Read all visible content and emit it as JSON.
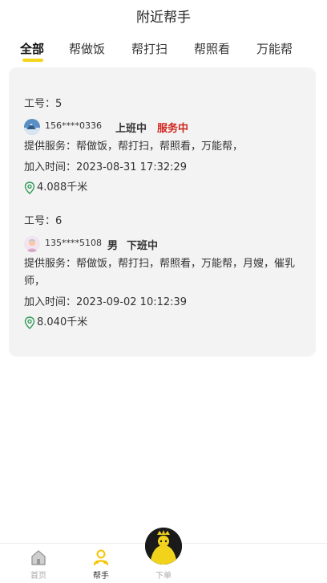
{
  "header": {
    "title": "附近帮手"
  },
  "tabs": [
    {
      "label": "全部",
      "active": true
    },
    {
      "label": "帮做饭",
      "active": false
    },
    {
      "label": "帮打扫",
      "active": false
    },
    {
      "label": "帮照看",
      "active": false
    },
    {
      "label": "万能帮",
      "active": false
    }
  ],
  "workers": [
    {
      "worker_no": "工号：5",
      "phone": "156****0336",
      "work_state": "上班中",
      "service_state": "服务中",
      "services": "提供服务：帮做饭，帮打扫，帮照看，万能帮，",
      "join_time": "加入时间：2023-08-31 17:32:29",
      "distance": "4.088千米"
    },
    {
      "worker_no": "工号：6",
      "phone": "135****5108",
      "gender": "男",
      "work_state": "下班中",
      "services": "提供服务：帮做饭，帮打扫，帮照看，万能帮，月嫂，催乳师，",
      "join_time": "加入时间：2023-09-02 10:12:39",
      "distance": "8.040千米"
    }
  ],
  "tabbar": {
    "items": [
      {
        "label": "首页",
        "icon": "home-icon",
        "active": false
      },
      {
        "label": "帮手",
        "icon": "helper-icon",
        "active": true
      },
      {
        "label": "下单",
        "icon": "order-icon",
        "active": false
      }
    ]
  },
  "colors": {
    "accent": "#f5d51a",
    "service_state": "#d0241a",
    "card_bg": "#f3f3f3"
  }
}
